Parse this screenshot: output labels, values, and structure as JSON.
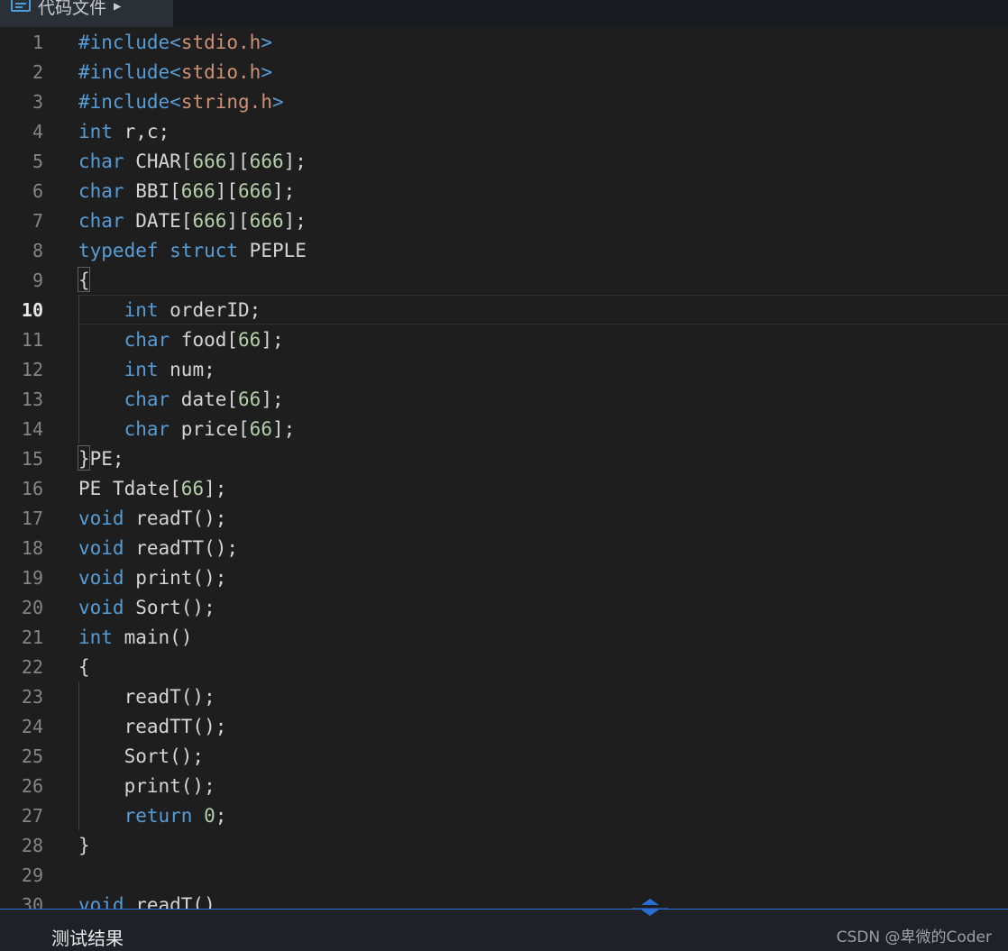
{
  "tab": {
    "label": "代码文件",
    "arrow": "▶"
  },
  "editor": {
    "active_line": 10,
    "lines": [
      {
        "n": "1",
        "tokens": [
          [
            "#include",
            "kw"
          ],
          [
            "<",
            "kw"
          ],
          [
            "stdio.h",
            "str"
          ],
          [
            ">",
            "kw"
          ]
        ]
      },
      {
        "n": "2",
        "tokens": [
          [
            "#include",
            "kw"
          ],
          [
            "<",
            "kw"
          ],
          [
            "stdio.h",
            "str"
          ],
          [
            ">",
            "kw"
          ]
        ]
      },
      {
        "n": "3",
        "tokens": [
          [
            "#include",
            "kw"
          ],
          [
            "<",
            "kw"
          ],
          [
            "string.h",
            "str"
          ],
          [
            ">",
            "kw"
          ]
        ]
      },
      {
        "n": "4",
        "tokens": [
          [
            "int",
            "kw"
          ],
          [
            " r,c;",
            "plain"
          ]
        ]
      },
      {
        "n": "5",
        "tokens": [
          [
            "char",
            "kw"
          ],
          [
            " CHAR[",
            "plain"
          ],
          [
            "666",
            "num"
          ],
          [
            "][",
            "plain"
          ],
          [
            "666",
            "num"
          ],
          [
            "];",
            "plain"
          ]
        ]
      },
      {
        "n": "6",
        "tokens": [
          [
            "char",
            "kw"
          ],
          [
            " BBI[",
            "plain"
          ],
          [
            "666",
            "num"
          ],
          [
            "][",
            "plain"
          ],
          [
            "666",
            "num"
          ],
          [
            "];",
            "plain"
          ]
        ]
      },
      {
        "n": "7",
        "tokens": [
          [
            "char",
            "kw"
          ],
          [
            " DATE[",
            "plain"
          ],
          [
            "666",
            "num"
          ],
          [
            "][",
            "plain"
          ],
          [
            "666",
            "num"
          ],
          [
            "];",
            "plain"
          ]
        ]
      },
      {
        "n": "8",
        "tokens": [
          [
            "typedef",
            "kw"
          ],
          [
            " ",
            "plain"
          ],
          [
            "struct",
            "kw"
          ],
          [
            " PEPLE",
            "plain"
          ]
        ]
      },
      {
        "n": "9",
        "tokens": [
          [
            "{",
            "plain"
          ]
        ]
      },
      {
        "n": "10",
        "tokens": [
          [
            "    ",
            "plain"
          ],
          [
            "int",
            "kw"
          ],
          [
            " orderID;",
            "plain"
          ]
        ]
      },
      {
        "n": "11",
        "tokens": [
          [
            "    ",
            "plain"
          ],
          [
            "char",
            "kw"
          ],
          [
            " food[",
            "plain"
          ],
          [
            "66",
            "num"
          ],
          [
            "];",
            "plain"
          ]
        ]
      },
      {
        "n": "12",
        "tokens": [
          [
            "    ",
            "plain"
          ],
          [
            "int",
            "kw"
          ],
          [
            " num;",
            "plain"
          ]
        ]
      },
      {
        "n": "13",
        "tokens": [
          [
            "    ",
            "plain"
          ],
          [
            "char",
            "kw"
          ],
          [
            " date[",
            "plain"
          ],
          [
            "66",
            "num"
          ],
          [
            "];",
            "plain"
          ]
        ]
      },
      {
        "n": "14",
        "tokens": [
          [
            "    ",
            "plain"
          ],
          [
            "char",
            "kw"
          ],
          [
            " price[",
            "plain"
          ],
          [
            "66",
            "num"
          ],
          [
            "];",
            "plain"
          ]
        ]
      },
      {
        "n": "15",
        "tokens": [
          [
            "}PE;",
            "plain"
          ]
        ]
      },
      {
        "n": "16",
        "tokens": [
          [
            "PE Tdate[",
            "plain"
          ],
          [
            "66",
            "num"
          ],
          [
            "];",
            "plain"
          ]
        ]
      },
      {
        "n": "17",
        "tokens": [
          [
            "void",
            "kw"
          ],
          [
            " readT();",
            "plain"
          ]
        ]
      },
      {
        "n": "18",
        "tokens": [
          [
            "void",
            "kw"
          ],
          [
            " readTT();",
            "plain"
          ]
        ]
      },
      {
        "n": "19",
        "tokens": [
          [
            "void",
            "kw"
          ],
          [
            " print();",
            "plain"
          ]
        ]
      },
      {
        "n": "20",
        "tokens": [
          [
            "void",
            "kw"
          ],
          [
            " Sort();",
            "plain"
          ]
        ]
      },
      {
        "n": "21",
        "tokens": [
          [
            "int",
            "kw"
          ],
          [
            " main()",
            "plain"
          ]
        ]
      },
      {
        "n": "22",
        "tokens": [
          [
            "{",
            "plain"
          ]
        ]
      },
      {
        "n": "23",
        "tokens": [
          [
            "    readT();",
            "plain"
          ]
        ]
      },
      {
        "n": "24",
        "tokens": [
          [
            "    readTT();",
            "plain"
          ]
        ]
      },
      {
        "n": "25",
        "tokens": [
          [
            "    Sort();",
            "plain"
          ]
        ]
      },
      {
        "n": "26",
        "tokens": [
          [
            "    print();",
            "plain"
          ]
        ]
      },
      {
        "n": "27",
        "tokens": [
          [
            "    ",
            "plain"
          ],
          [
            "return",
            "kw"
          ],
          [
            " ",
            "plain"
          ],
          [
            "0",
            "num"
          ],
          [
            ";",
            "plain"
          ]
        ]
      },
      {
        "n": "28",
        "tokens": [
          [
            "}",
            "plain"
          ]
        ]
      },
      {
        "n": "29",
        "tokens": []
      },
      {
        "n": "30",
        "tokens": [
          [
            "void",
            "kw"
          ],
          [
            " readT()",
            "plain"
          ]
        ]
      }
    ]
  },
  "bottom_panel": {
    "label": "测试结果",
    "watermark": "CSDN @卑微的Coder"
  },
  "icons": {
    "tab": "code-file-icon",
    "resize": "resize-handle-icon"
  },
  "colors": {
    "keyword": "#569cd6",
    "string": "#ce9178",
    "number": "#b5cea8",
    "text": "#d4d4d4",
    "accent": "#2a6fd6"
  }
}
